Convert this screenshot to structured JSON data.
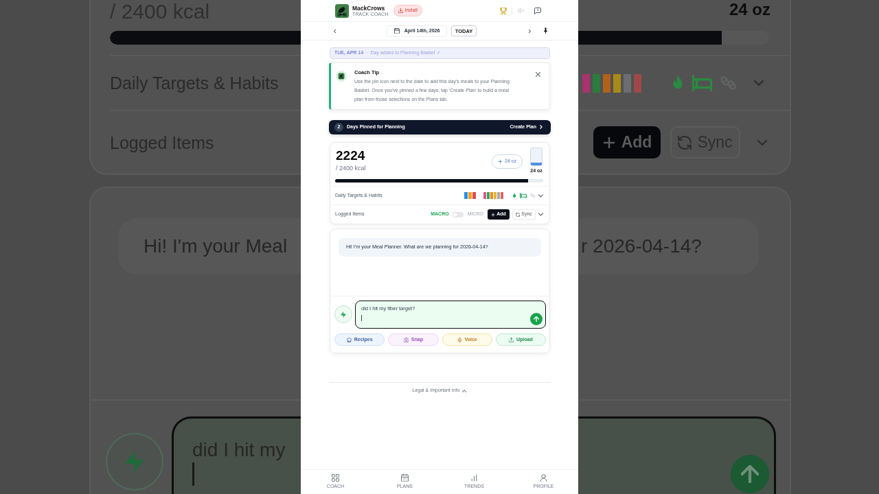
{
  "backdrop": {
    "left": {
      "calorie_goal": "/ 2400 kcal",
      "progress": {
        "level": 1
      },
      "targets_label": "Daily Targets & Habits",
      "logged_label": "Logged Items",
      "assistant_message": "Hi! I'm your Meal",
      "input_value": "did I hit my"
    },
    "right": {
      "water_amount": "24 oz",
      "progress": {
        "level": 0.75
      },
      "micro_bars": [
        {
          "color": "#a8336d"
        },
        {
          "color": "#2b7d3e"
        },
        {
          "color": "#b0621a"
        },
        {
          "color": "#a88a18"
        },
        {
          "color": "#6d6e74"
        },
        {
          "color": "#a04848"
        }
      ],
      "habits": [
        {
          "kind": "flame",
          "done": true
        },
        {
          "kind": "bed",
          "done": true
        },
        {
          "kind": "pills",
          "done": false
        }
      ],
      "add_button": "Add",
      "sync_button": "Sync",
      "assistant_message": "r 2026-04-14?"
    }
  },
  "header": {
    "app_name": "MackCrows",
    "tagline": "TRACK COACH",
    "install_button": "Install"
  },
  "date_bar": {
    "date": "April 14th, 2026",
    "today_button": "TODAY"
  },
  "banner": {
    "date": "TUE, APR 14",
    "separator": "·",
    "message": "Day added to Planning Basket ✓"
  },
  "coach_tip": {
    "title": "Coach Tip",
    "body": "Use the pin icon next to the date to add this day's meals to your Planning Basket. Once you've pinned a few days, tap 'Create Plan' to build a meal plan from those selections on the Plans tab."
  },
  "pinned_bar": {
    "count": "2",
    "label": "Days Pinned for Planning",
    "action": "Create Plan"
  },
  "summary": {
    "calories": "2224",
    "goal": "/ 2400 kcal",
    "water_button": "24 oz",
    "water": {
      "level": 0.18,
      "amount": "24 oz"
    },
    "calorie_progress": {
      "level": 0.927
    },
    "targets": {
      "label": "Daily Targets & Habits",
      "macro_bars": [
        {
          "color": "#2f8fe0"
        },
        {
          "color": "#f0a023"
        },
        {
          "color": "#e34a4a"
        }
      ],
      "micro_bars": [
        {
          "color": "#e2558f"
        },
        {
          "color": "#2fa85a"
        },
        {
          "color": "#e8892a"
        },
        {
          "color": "#e7b62c"
        },
        {
          "color": "#a5a9b3"
        },
        {
          "color": "#e26464"
        }
      ],
      "habits": [
        {
          "kind": "flame",
          "done": true
        },
        {
          "kind": "bed",
          "done": true
        },
        {
          "kind": "pills",
          "done": false
        }
      ]
    },
    "logged": {
      "label": "Logged Items",
      "modes": [
        {
          "label": "MACRO",
          "selected": true
        },
        {
          "label": "MICRO",
          "selected": false
        }
      ],
      "add_button": "Add",
      "sync_button": "Sync"
    }
  },
  "chat": {
    "greeting": "Hi! I'm your Meal Planner. What are we planning for 2026-04-14?",
    "input": {
      "value": "did I hit my fiber target?"
    },
    "quick_actions": [
      {
        "kind": "recipes",
        "label": "Recipes"
      },
      {
        "kind": "snap",
        "label": "Snap"
      },
      {
        "kind": "voice",
        "label": "Voice"
      },
      {
        "kind": "upload",
        "label": "Upload"
      }
    ]
  },
  "footer": {
    "legal_link": "Legal & Important Info"
  },
  "bottom_nav": [
    {
      "kind": "grid",
      "label": "COACH"
    },
    {
      "kind": "calendar",
      "label": "PLANS"
    },
    {
      "kind": "chart",
      "label": "TRENDS"
    },
    {
      "kind": "user",
      "label": "PROFILE"
    }
  ]
}
